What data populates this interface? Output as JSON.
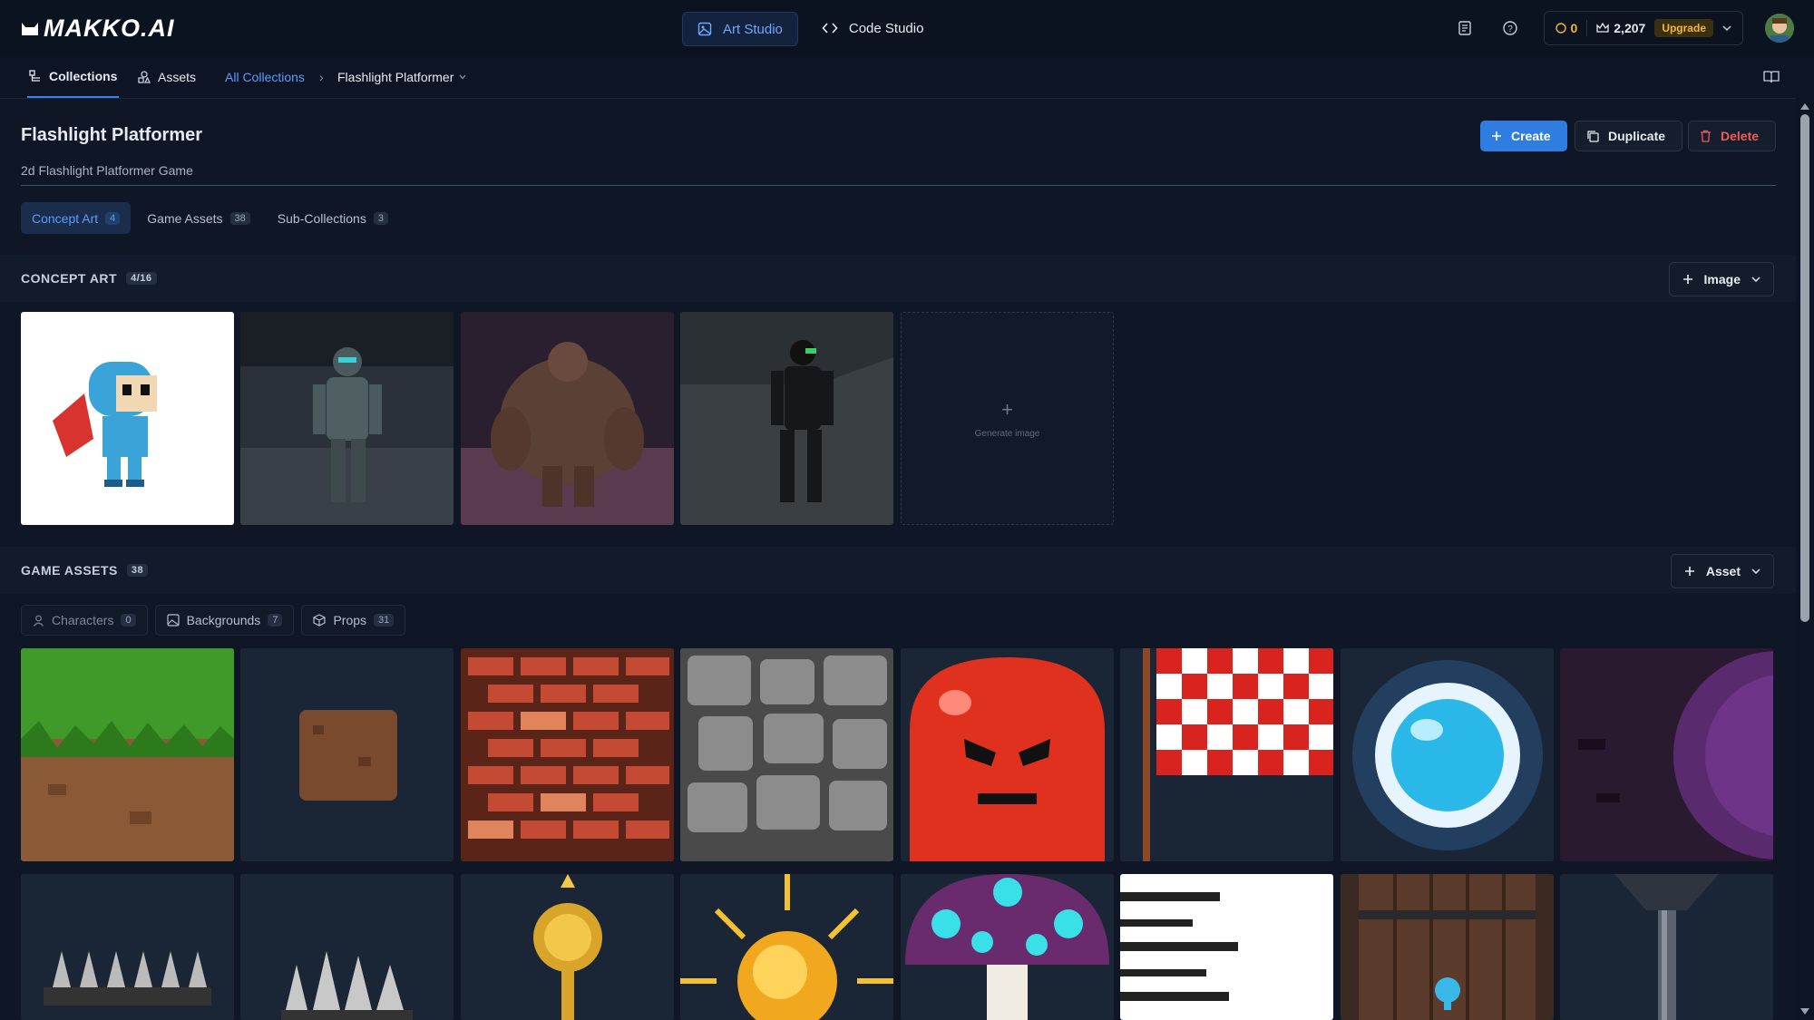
{
  "app": {
    "logo": "MAKKO.AI",
    "studio_tabs": [
      "Art Studio",
      "Code Studio"
    ],
    "coins": "0",
    "credits": "2,207",
    "upgrade": "Upgrade"
  },
  "subnav": {
    "tabs": [
      "Collections",
      "Assets"
    ],
    "breadcrumb_root": "All Collections",
    "breadcrumb_current": "Flashlight Platformer"
  },
  "collection": {
    "title": "Flashlight Platformer",
    "description": "2d Flashlight Platformer Game",
    "buttons": {
      "create": "Create",
      "duplicate": "Duplicate",
      "delete": "Delete"
    },
    "tabs": [
      {
        "label": "Concept Art",
        "count": "4"
      },
      {
        "label": "Game Assets",
        "count": "38"
      },
      {
        "label": "Sub-Collections",
        "count": "3"
      }
    ]
  },
  "concept_art": {
    "title": "CONCEPT ART",
    "count": "4/16",
    "add_button": "Image",
    "generate_label": "Generate image"
  },
  "game_assets": {
    "title": "GAME ASSETS",
    "count": "38",
    "add_button": "Asset",
    "filters": [
      {
        "label": "Characters",
        "count": "0"
      },
      {
        "label": "Backgrounds",
        "count": "7"
      },
      {
        "label": "Props",
        "count": "31"
      }
    ]
  },
  "colors": {
    "accent": "#2f7de1",
    "danger": "#ef5b5b",
    "gold": "#f2b933"
  }
}
